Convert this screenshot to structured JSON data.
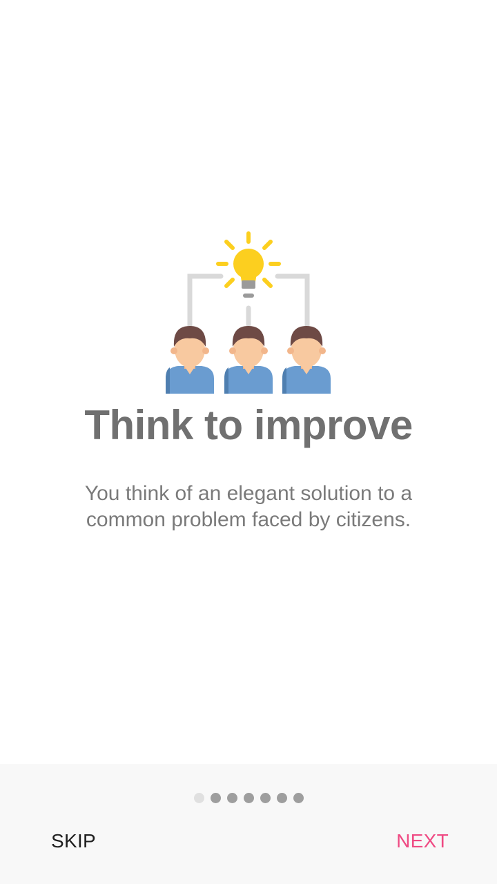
{
  "onboarding": {
    "title": "Think to improve",
    "description": "You think of an elegant solution to a common problem faced by citizens.",
    "illustration_icon": "team-idea-lightbulb-icon"
  },
  "pager": {
    "total": 7,
    "current": 1
  },
  "footer": {
    "skip_label": "SKIP",
    "next_label": "NEXT"
  },
  "colors": {
    "accent": "#ef4a83",
    "title": "#707070",
    "footer_bg": "#f8f8f8",
    "bulb": "#fccf1f",
    "shirt": "#6a9cd0",
    "hair": "#6e4a45",
    "skin": "#f8c9a0"
  }
}
